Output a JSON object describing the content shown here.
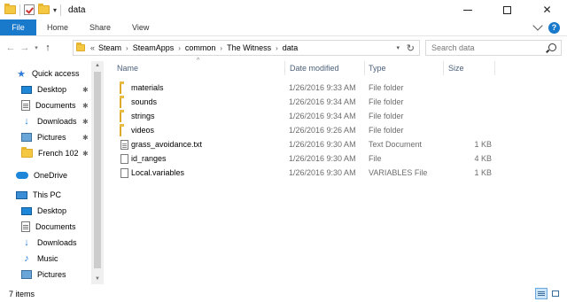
{
  "window": {
    "title": "data"
  },
  "ribbon": {
    "tabs": [
      "File",
      "Home",
      "Share",
      "View"
    ]
  },
  "address": {
    "crumbs": [
      "Steam",
      "SteamApps",
      "common",
      "The Witness",
      "data"
    ],
    "overflow": "«"
  },
  "search": {
    "placeholder": "Search data"
  },
  "navpane": {
    "quick_access": "Quick access",
    "quick_items": [
      {
        "label": "Desktop",
        "icon": "desktop-icon",
        "pinned": true
      },
      {
        "label": "Documents",
        "icon": "documents-icon",
        "pinned": true
      },
      {
        "label": "Downloads",
        "icon": "downloads-icon",
        "pinned": true
      },
      {
        "label": "Pictures",
        "icon": "pictures-icon",
        "pinned": true
      },
      {
        "label": "French 102",
        "icon": "folder-icon",
        "pinned": true
      }
    ],
    "onedrive": "OneDrive",
    "this_pc": "This PC",
    "pc_items": [
      {
        "label": "Desktop",
        "icon": "desktop-icon"
      },
      {
        "label": "Documents",
        "icon": "documents-icon"
      },
      {
        "label": "Downloads",
        "icon": "downloads-icon"
      },
      {
        "label": "Music",
        "icon": "music-icon"
      },
      {
        "label": "Pictures",
        "icon": "pictures-icon"
      }
    ]
  },
  "columns": {
    "name": "Name",
    "date": "Date modified",
    "type": "Type",
    "size": "Size"
  },
  "files": [
    {
      "name": "materials",
      "date": "1/26/2016 9:33 AM",
      "type": "File folder",
      "size": "",
      "icon": "folder-icon"
    },
    {
      "name": "sounds",
      "date": "1/26/2016 9:34 AM",
      "type": "File folder",
      "size": "",
      "icon": "folder-icon"
    },
    {
      "name": "strings",
      "date": "1/26/2016 9:34 AM",
      "type": "File folder",
      "size": "",
      "icon": "folder-icon"
    },
    {
      "name": "videos",
      "date": "1/26/2016 9:26 AM",
      "type": "File folder",
      "size": "",
      "icon": "folder-icon"
    },
    {
      "name": "grass_avoidance.txt",
      "date": "1/26/2016 9:30 AM",
      "type": "Text Document",
      "size": "1 KB",
      "icon": "text-file-icon"
    },
    {
      "name": "id_ranges",
      "date": "1/26/2016 9:30 AM",
      "type": "File",
      "size": "4 KB",
      "icon": "file-icon"
    },
    {
      "name": "Local.variables",
      "date": "1/26/2016 9:30 AM",
      "type": "VARIABLES File",
      "size": "1 KB",
      "icon": "file-icon"
    }
  ],
  "status": {
    "item_count": "7 items"
  },
  "colors": {
    "accent": "#1979ca",
    "folder": "#f8d56a",
    "column_header": "#4c607a",
    "secondary_text": "#6d6d6d"
  }
}
